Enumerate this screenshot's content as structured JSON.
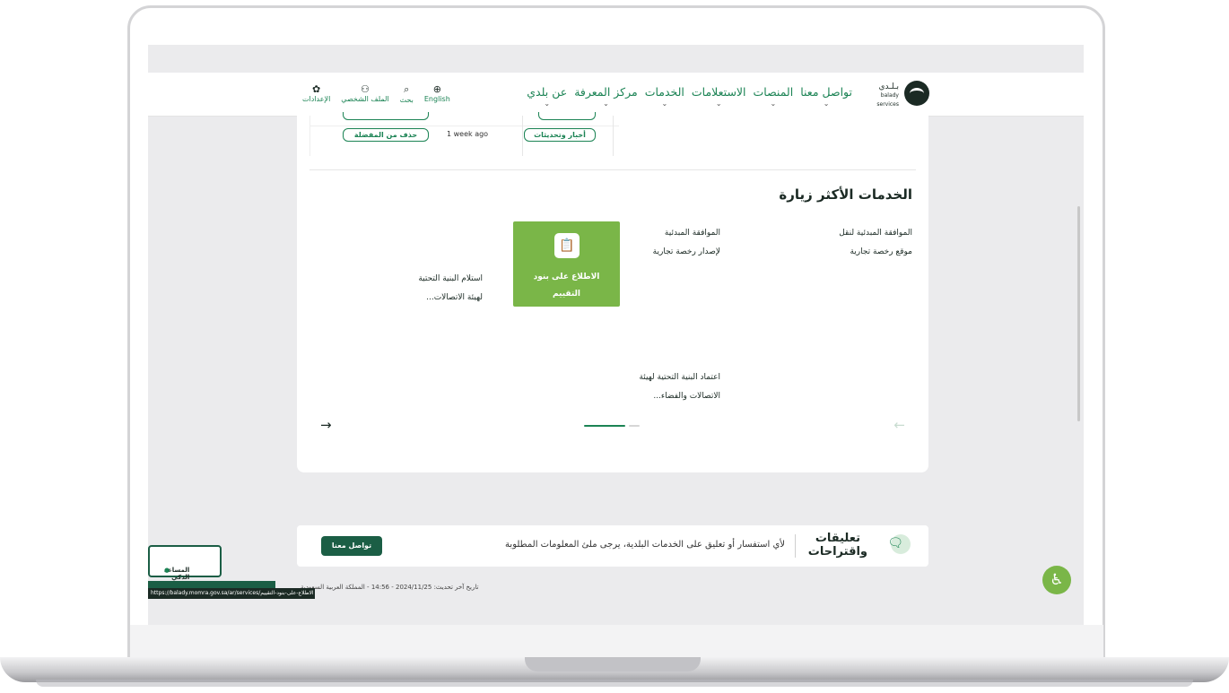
{
  "nav": {
    "logo_text": "بـلـدي",
    "logo_sub": "balady services",
    "menu": [
      {
        "label": "عن بلدي"
      },
      {
        "label": "مركز المعرفة"
      },
      {
        "label": "الخدمات"
      },
      {
        "label": "الاستعلامات"
      },
      {
        "label": "المنصات"
      },
      {
        "label": "تواصل معنا"
      }
    ],
    "chevron": "⌄",
    "tools": {
      "language": "English",
      "search": "بحث",
      "profile": "الملف الشخصي",
      "settings": "الإعدادات"
    }
  },
  "favorites": {
    "row": {
      "category": "أخبار وتحديثات",
      "time": "1 week ago",
      "remove_label": "حذف من المفضلة"
    }
  },
  "most_visited": {
    "title": "الخدمات الأكثر زيارة",
    "services": [
      {
        "line1": "الموافقة المبدئية لنقل",
        "line2": "موقع رخصة تجارية"
      },
      {
        "line1": "الموافقة المبدئية",
        "line2": "لإصدار رخصة تجارية"
      },
      {
        "line1": "الاطلاع على بنود",
        "line2": "التقييم"
      },
      {
        "line1": "استلام البنية التحتية",
        "line2": "لهيئة الاتصالات..."
      },
      {
        "line1": "اعتماد البنية التحتية لهيئة",
        "line2": "الاتصالات والفضاء..."
      }
    ],
    "next_arrow": "→",
    "prev_arrow": "←"
  },
  "feedback": {
    "title_line1": "تعليقات",
    "title_line2": "واقتراحات",
    "text": "لأي استفسار أو تعليق على الخدمات البلدية، يرجى ملئ المعلومات المطلوبة",
    "button": "تواصل معنا"
  },
  "footer": {
    "updated": "تاريخ آخر تحديث: 2024/11/25 - 14:56 - المملكة العربية السعودية"
  },
  "status_url": "https://balady.momra.gov.sa/ar/services/الاطلاع-على-بنود-التقييم",
  "assistant": {
    "label": "المساعد الذكي"
  },
  "colors": {
    "brand_green": "#1b8354",
    "active_tile": "#7ab648",
    "dark": "#1b2a24"
  }
}
